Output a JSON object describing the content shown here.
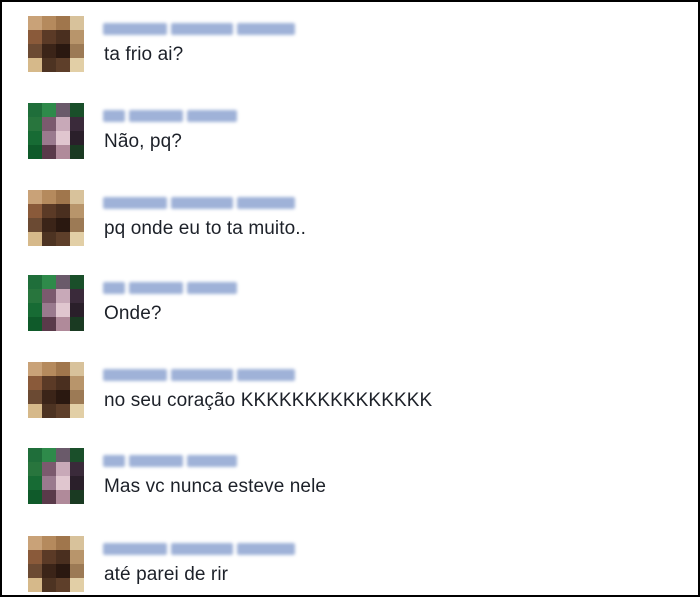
{
  "chat": {
    "messages": [
      {
        "sender": "a",
        "text": "ta frio ai?"
      },
      {
        "sender": "b",
        "text": "Não, pq?"
      },
      {
        "sender": "a",
        "text": "pq onde eu to ta muito.."
      },
      {
        "sender": "b",
        "text": "Onde?"
      },
      {
        "sender": "a",
        "text": "no seu coração KKKKKKKKKKKKKKK"
      },
      {
        "sender": "b",
        "text": "Mas vc nunca esteve nele"
      },
      {
        "sender": "a",
        "text": "até parei de rir"
      }
    ]
  },
  "colors": {
    "text": "#1d2129",
    "name_blur": "#9fb2d8",
    "frame": "#000000"
  },
  "icons": {
    "avatar_a": "pixelated-avatar-icon",
    "avatar_b": "pixelated-avatar-icon"
  }
}
